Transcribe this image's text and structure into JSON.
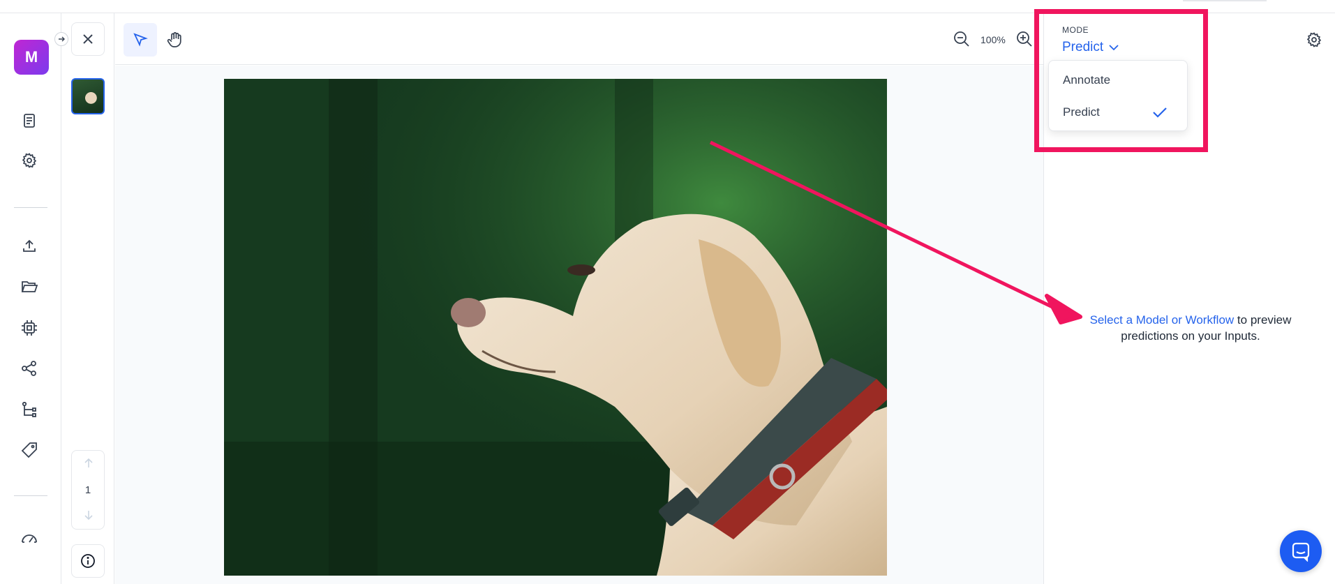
{
  "app": {
    "logo_letter": "M"
  },
  "pager": {
    "current_page": "1"
  },
  "toolbar": {
    "zoom_label": "100%"
  },
  "right_panel": {
    "mode_label": "MODE",
    "mode_selected": "Predict",
    "dropdown_options": [
      "Annotate",
      "Predict"
    ],
    "message_link": "Select a Model or Workflow",
    "message_rest": " to preview predictions on your Inputs."
  },
  "colors": {
    "accent": "#2563eb",
    "annotation": "#f0155e",
    "logo_gradient_start": "#c026d3",
    "logo_gradient_end": "#7c3aed",
    "chat": "#1d5cf2"
  },
  "icons": {
    "sidebar": [
      "document-icon",
      "settings-icon",
      "upload-icon",
      "folder-open-icon",
      "cpu-chip-icon",
      "share-icon",
      "workflow-icon",
      "tag-icon",
      "gauge-icon"
    ],
    "toolbar": [
      "pointer-icon",
      "hand-icon",
      "zoom-out-icon",
      "zoom-in-icon"
    ]
  }
}
